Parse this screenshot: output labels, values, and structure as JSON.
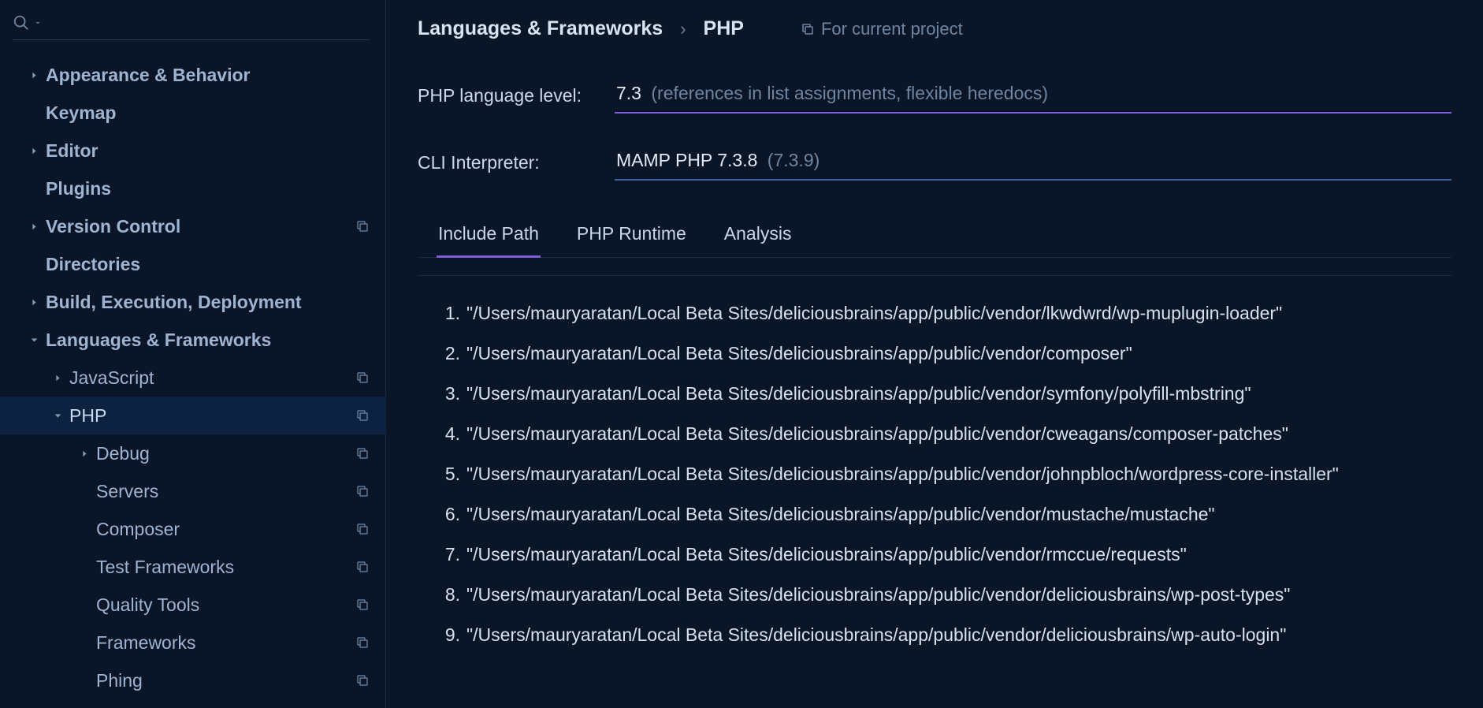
{
  "breadcrumb": {
    "parent": "Languages & Frameworks",
    "current": "PHP",
    "badge": "For current project"
  },
  "form": {
    "lang_level_label": "PHP language level:",
    "lang_level_value": "7.3",
    "lang_level_hint": "(references in list assignments, flexible heredocs)",
    "cli_label": "CLI Interpreter:",
    "cli_value": "MAMP PHP 7.3.8",
    "cli_hint": "(7.3.9)"
  },
  "tabs": {
    "include_path": "Include Path",
    "php_runtime": "PHP Runtime",
    "analysis": "Analysis"
  },
  "sidebar": {
    "appearance": "Appearance & Behavior",
    "keymap": "Keymap",
    "editor": "Editor",
    "plugins": "Plugins",
    "version_control": "Version Control",
    "directories": "Directories",
    "build": "Build, Execution, Deployment",
    "languages": "Languages & Frameworks",
    "javascript": "JavaScript",
    "php": "PHP",
    "debug": "Debug",
    "servers": "Servers",
    "composer": "Composer",
    "test_frameworks": "Test Frameworks",
    "quality_tools": "Quality Tools",
    "frameworks": "Frameworks",
    "phing": "Phing"
  },
  "paths": [
    "\"/Users/mauryaratan/Local Beta Sites/deliciousbrains/app/public/vendor/lkwdwrd/wp-muplugin-loader\"",
    "\"/Users/mauryaratan/Local Beta Sites/deliciousbrains/app/public/vendor/composer\"",
    "\"/Users/mauryaratan/Local Beta Sites/deliciousbrains/app/public/vendor/symfony/polyfill-mbstring\"",
    "\"/Users/mauryaratan/Local Beta Sites/deliciousbrains/app/public/vendor/cweagans/composer-patches\"",
    "\"/Users/mauryaratan/Local Beta Sites/deliciousbrains/app/public/vendor/johnpbloch/wordpress-core-installer\"",
    "\"/Users/mauryaratan/Local Beta Sites/deliciousbrains/app/public/vendor/mustache/mustache\"",
    "\"/Users/mauryaratan/Local Beta Sites/deliciousbrains/app/public/vendor/rmccue/requests\"",
    "\"/Users/mauryaratan/Local Beta Sites/deliciousbrains/app/public/vendor/deliciousbrains/wp-post-types\"",
    "\"/Users/mauryaratan/Local Beta Sites/deliciousbrains/app/public/vendor/deliciousbrains/wp-auto-login\""
  ]
}
